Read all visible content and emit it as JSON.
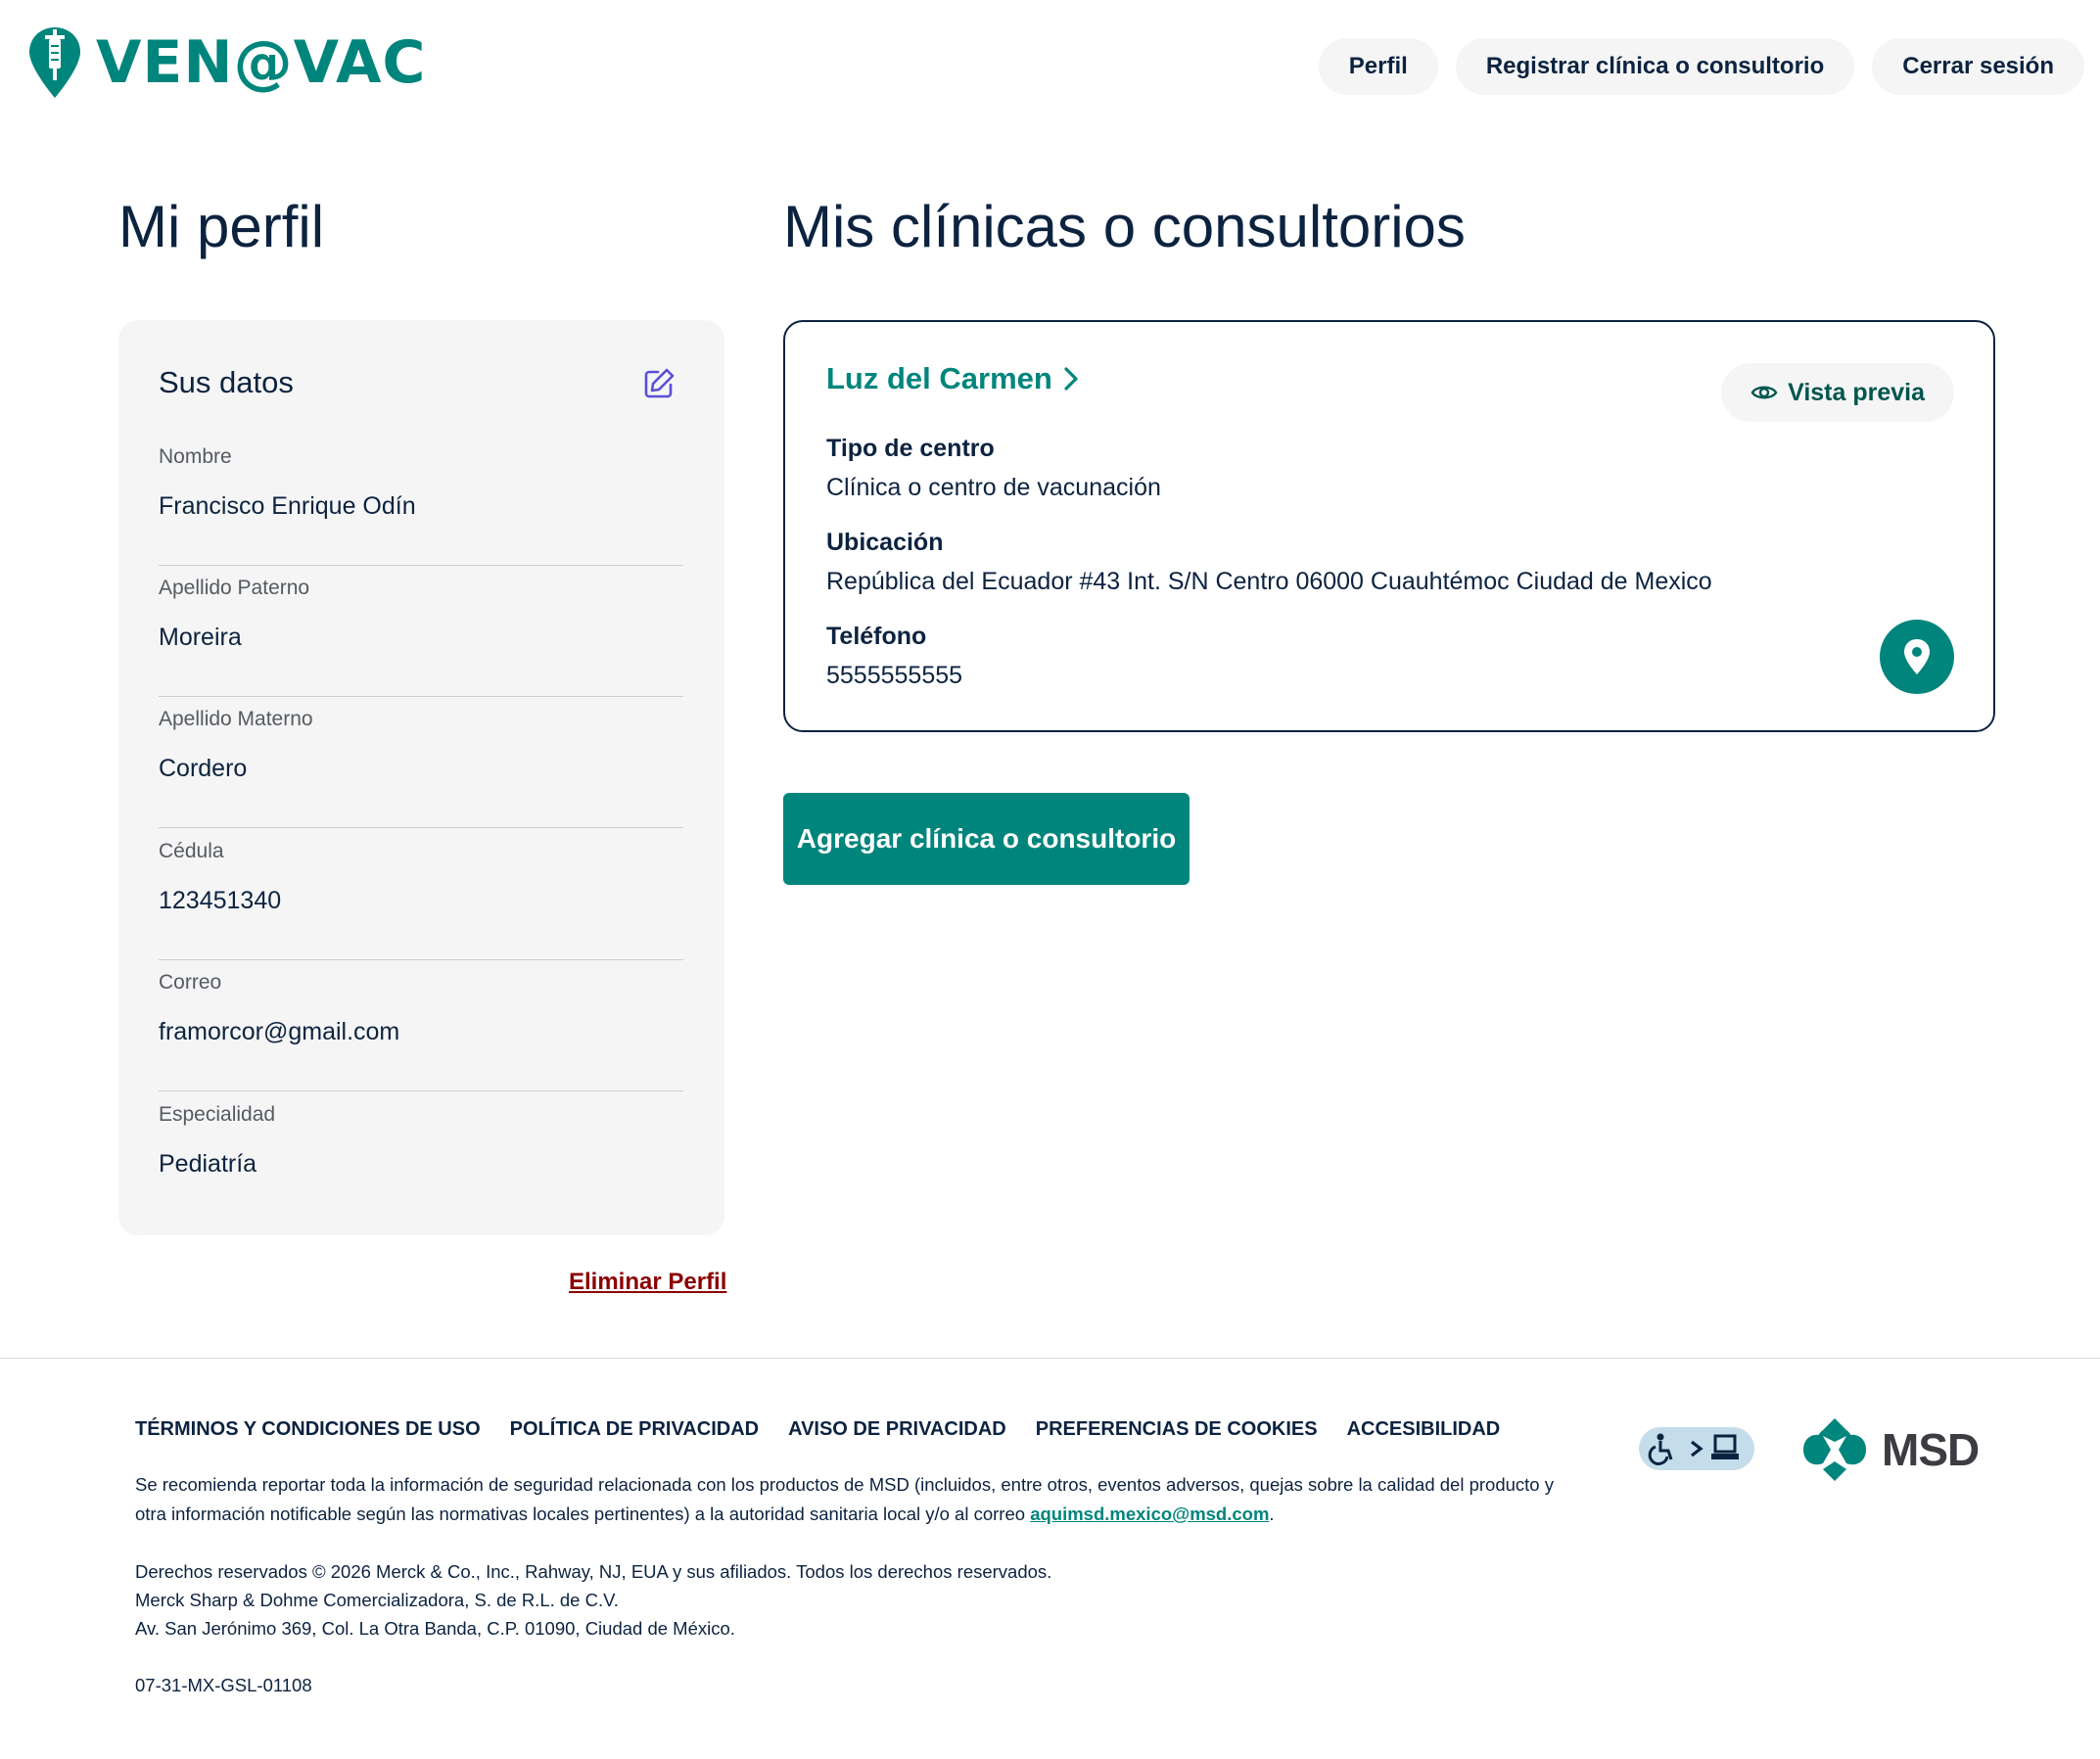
{
  "header": {
    "logo_text": "VEN@VAC",
    "nav": [
      "Perfil",
      "Registrar clínica o consultorio",
      "Cerrar sesión"
    ]
  },
  "profile": {
    "heading": "Mi perfil",
    "card_title": "Sus datos",
    "fields": [
      {
        "label": "Nombre",
        "value": "Francisco Enrique Odín"
      },
      {
        "label": "Apellido Paterno",
        "value": "Moreira"
      },
      {
        "label": "Apellido Materno",
        "value": "Cordero"
      },
      {
        "label": "Cédula",
        "value": "123451340"
      },
      {
        "label": "Correo",
        "value": "framorcor@gmail.com"
      },
      {
        "label": "Especialidad",
        "value": "Pediatría"
      }
    ],
    "delete_label": "Eliminar Perfil"
  },
  "clinics": {
    "heading": "Mis clínicas o consultorios",
    "items": [
      {
        "name": "Luz del Carmen",
        "preview_label": "Vista previa",
        "type_label": "Tipo de centro",
        "type_value": "Clínica o centro de vacunación",
        "location_label": "Ubicación",
        "location_value": "República del Ecuador #43 Int. S/N Centro 06000 Cuauhtémoc Ciudad de Mexico",
        "phone_label": "Teléfono",
        "phone_value": "5555555555"
      }
    ],
    "add_label": "Agregar clínica o consultorio"
  },
  "footer": {
    "links": [
      "TÉRMINOS Y CONDICIONES DE USO",
      "POLÍTICA DE PRIVACIDAD",
      "AVISO DE PRIVACIDAD",
      "PREFERENCIAS DE COOKIES",
      "ACCESIBILIDAD"
    ],
    "notice_line1": "Se recomienda reportar toda la información de seguridad relacionada con los productos de MSD (incluidos, entre otros, eventos adversos, quejas sobre la calidad del producto y",
    "notice_line2": "otra información notificable según las normativas locales pertinentes) a la autoridad sanitaria local y/o al correo",
    "notice_email": "aquimsd.mexico@msd.com",
    "notice_end": ".",
    "rights": "Derechos reservados © 2026 Merck & Co., Inc., Rahway, NJ, EUA y sus afiliados. Todos los derechos reservados.",
    "company": "Merck Sharp & Dohme Comercializadora, S. de R.L. de C.V.",
    "address": "Av. San Jerónimo 369, Col. La Otra Banda, C.P. 01090, Ciudad de México.",
    "code": "07-31-MX-GSL-01108",
    "brand": "MSD"
  },
  "colors": {
    "brand_teal": "#00857c",
    "navy": "#0c2340",
    "card_gray": "#f5f5f5",
    "delete_red": "#8b0000",
    "edit_purple": "#5b4fd6"
  },
  "icons": [
    "vaccine-pin-icon",
    "edit-icon",
    "chevron-right-icon",
    "eye-icon",
    "location-pin-icon",
    "accessibility-icon",
    "msd-logo-icon"
  ]
}
